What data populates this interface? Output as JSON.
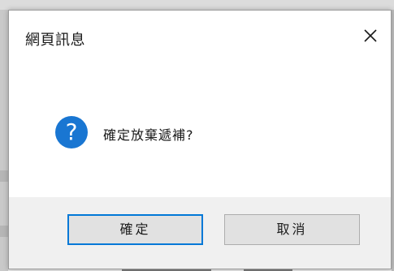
{
  "dialog": {
    "title": "網頁訊息",
    "message": "確定放棄遞補?",
    "icon": "question-icon",
    "close_icon": "close-icon",
    "buttons": {
      "ok_label": "確定",
      "cancel_label": "取消"
    }
  },
  "colors": {
    "accent": "#0078d7",
    "icon_bg": "#1976d2",
    "footer_bg": "#f0f0f0",
    "button_bg": "#e1e1e1"
  }
}
